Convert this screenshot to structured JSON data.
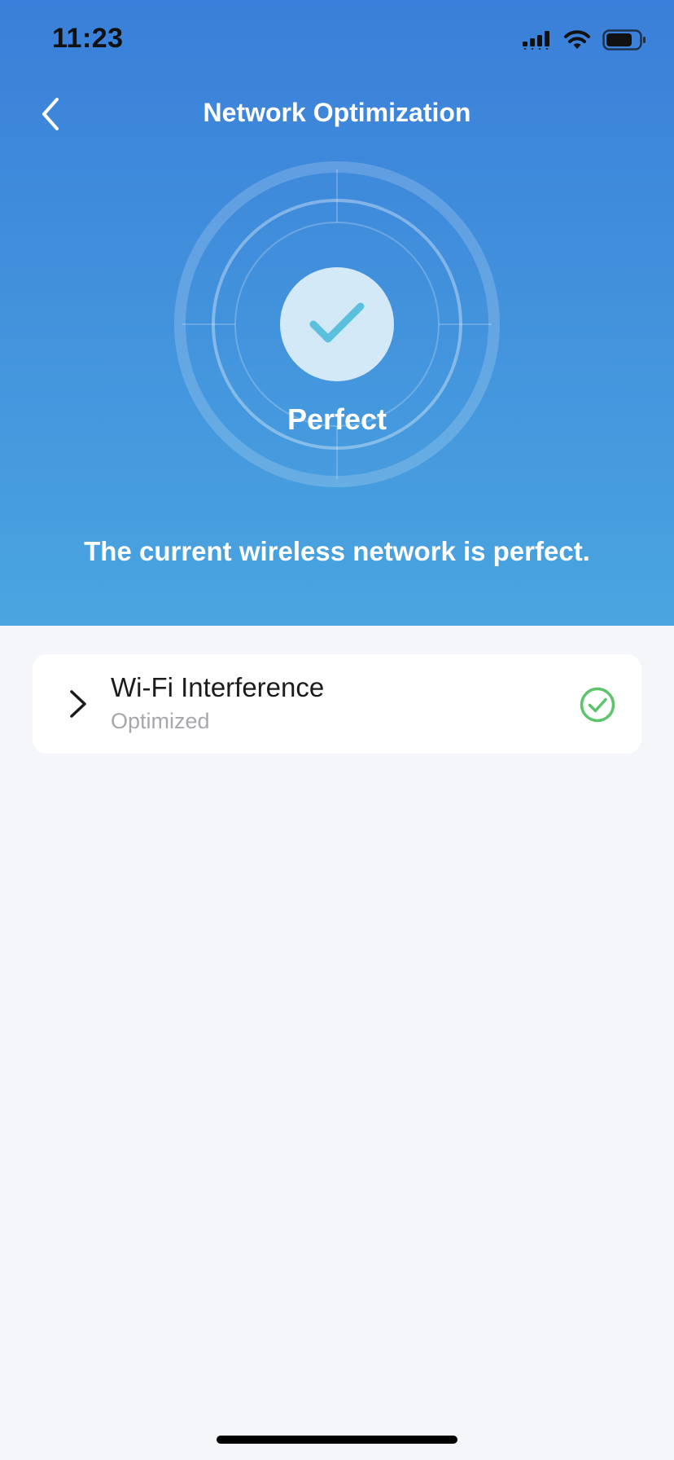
{
  "status_bar": {
    "time": "11:23"
  },
  "nav": {
    "title": "Network Optimization",
    "back_icon": "chevron-left-icon"
  },
  "hero": {
    "status_label": "Perfect",
    "summary": "The current wireless network is perfect.",
    "check_icon": "checkmark-icon"
  },
  "items": [
    {
      "title": "Wi-Fi Interference",
      "subtitle": "Optimized",
      "icon": "check-circle-icon",
      "status_color": "#5cc46a"
    }
  ],
  "colors": {
    "hero_top": "#3a7fd9",
    "hero_bottom": "#4aa5e0",
    "background": "#f4f6fa",
    "check_accent": "#5bc0de",
    "success": "#5cc46a"
  }
}
